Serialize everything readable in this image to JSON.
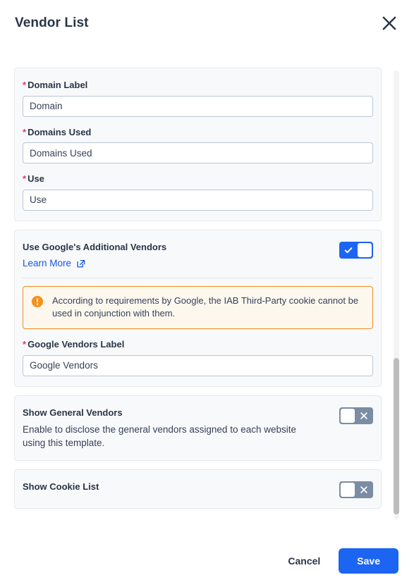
{
  "header": {
    "title": "Vendor List",
    "close_icon": "close-icon"
  },
  "form": {
    "required_marker": "*",
    "fields": [
      {
        "label": "Domain Label",
        "value": "Domain",
        "placeholder": "Domain",
        "required": true
      },
      {
        "label": "Domains Used",
        "value": "Domains Used",
        "placeholder": "Domains Used",
        "required": true
      },
      {
        "label": "Use",
        "value": "Use",
        "placeholder": "Use",
        "required": true
      }
    ]
  },
  "google_vendors": {
    "title": "Use Google's Additional Vendors",
    "learn_more_label": "Learn More",
    "learn_more_icon": "external-link-icon",
    "toggle_state": "on",
    "toggle_on_icon": "check-icon",
    "alert": {
      "icon": "alert-circle-icon",
      "text": "According to requirements by Google, the IAB Third-Party cookie cannot be used in conjunction with them."
    },
    "label_field": {
      "label": "Google Vendors Label",
      "value": "Google Vendors",
      "placeholder": "Google Vendors",
      "required": true
    }
  },
  "general_vendors": {
    "title": "Show General Vendors",
    "description": "Enable to disclose the general vendors assigned to each website using this template.",
    "toggle_state": "off",
    "toggle_off_icon": "close-icon"
  },
  "cookie_list": {
    "title": "Show Cookie List",
    "toggle_state": "off",
    "toggle_off_icon": "close-icon"
  },
  "footer": {
    "cancel_label": "Cancel",
    "save_label": "Save"
  },
  "colors": {
    "accent_blue": "#1c64f2",
    "link_blue": "#1a56db",
    "toggle_off_gray": "#7b8ca5",
    "alert_orange": "#f08c1e",
    "required_pink": "#e8366f",
    "text_dark": "#2a3547"
  }
}
